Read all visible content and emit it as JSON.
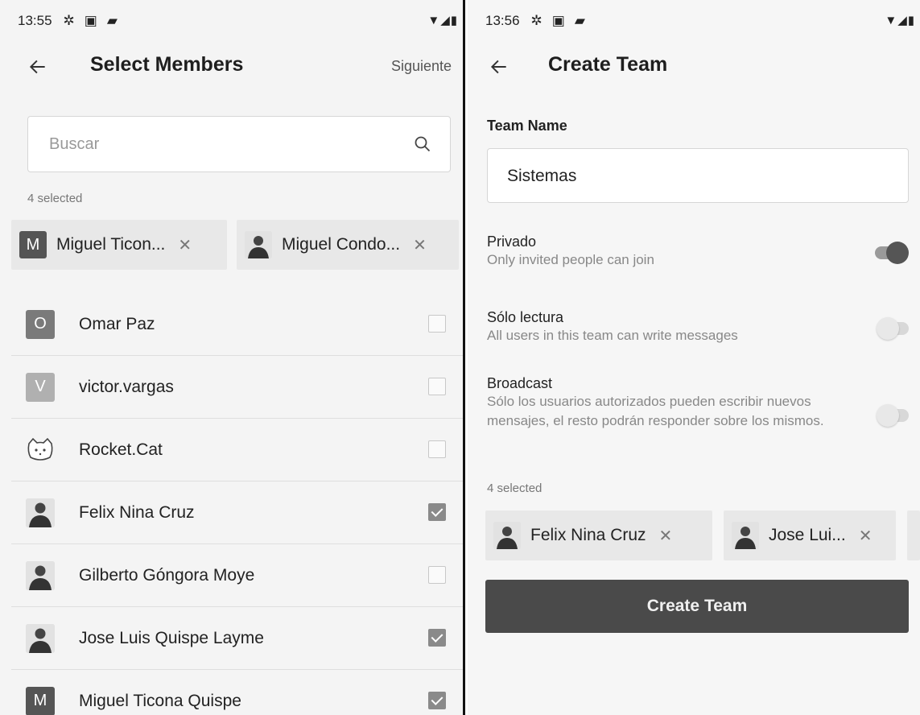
{
  "left_screen": {
    "status": {
      "time": "13:55"
    },
    "appbar": {
      "title": "Select Members",
      "action": "Siguiente"
    },
    "search": {
      "placeholder": "Buscar"
    },
    "selected_count": "4 selected",
    "chips": [
      {
        "initial": "M",
        "label": "Miguel Ticon...",
        "avatar": "letter",
        "color": "#555555"
      },
      {
        "initial": "",
        "label": "Miguel Condo...",
        "avatar": "photo"
      }
    ],
    "members": [
      {
        "initial": "O",
        "name": "Omar Paz",
        "avatar": "letter",
        "color": "#7a7a7a",
        "checked": false
      },
      {
        "initial": "V",
        "name": "victor.vargas",
        "avatar": "letter",
        "color": "#b0b0b0",
        "checked": false
      },
      {
        "initial": "",
        "name": "Rocket.Cat",
        "avatar": "cat",
        "checked": false
      },
      {
        "initial": "",
        "name": "Felix Nina Cruz",
        "avatar": "photo",
        "checked": true
      },
      {
        "initial": "",
        "name": "Gilberto Góngora Moye",
        "avatar": "photo",
        "checked": false
      },
      {
        "initial": "",
        "name": "Jose Luis Quispe Layme",
        "avatar": "photo",
        "checked": true
      },
      {
        "initial": "M",
        "name": "Miguel Ticona Quispe",
        "avatar": "letter",
        "color": "#555555",
        "checked": true
      }
    ]
  },
  "right_screen": {
    "status": {
      "time": "13:56"
    },
    "appbar": {
      "title": "Create Team"
    },
    "team_name": {
      "label": "Team Name",
      "value": "Sistemas"
    },
    "settings": [
      {
        "title": "Privado",
        "desc": "Only invited people can join",
        "on": true
      },
      {
        "title": "Sólo lectura",
        "desc": "All users in this team can write messages",
        "on": false
      },
      {
        "title": "Broadcast",
        "desc": "Sólo los usuarios autorizados pueden escribir nuevos mensajes, el resto podrán responder sobre los mismos.",
        "on": false
      }
    ],
    "selected_count": "4 selected",
    "chips": [
      {
        "label": "Felix Nina Cruz",
        "avatar": "photo"
      },
      {
        "label": "Jose Lui...",
        "avatar": "photo"
      }
    ],
    "create_button": "Create Team"
  },
  "colors": {
    "accent": "#4a4a4a",
    "background": "#f4f4f4",
    "muted_text": "#888888"
  },
  "icons": {
    "back": "arrow-left-icon",
    "search": "search-icon",
    "close": "close-icon",
    "settings": "gear-icon",
    "image": "image-icon",
    "sd": "sd-card-icon",
    "wifi": "wifi-icon",
    "signal": "signal-icon",
    "battery": "battery-icon"
  }
}
